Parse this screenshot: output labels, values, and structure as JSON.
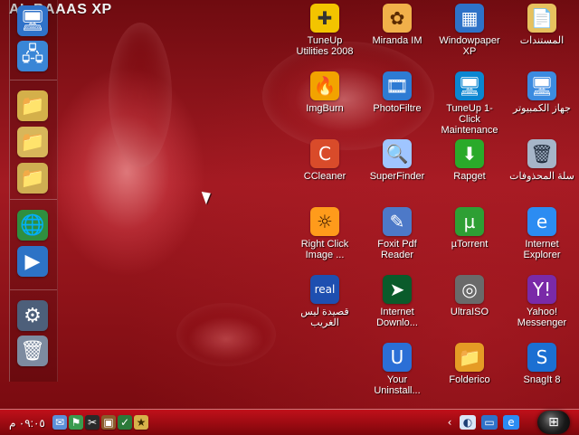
{
  "watermark": {
    "text": "AL BAAAS XP"
  },
  "taskbar": {
    "clock": "٠٩:٠٥ م",
    "start_icon_name": "windows-start-icon"
  },
  "dock": {
    "items": [
      {
        "icon": "my-computer-icon"
      },
      {
        "icon": "network-computer-icon"
      },
      {
        "icon": "folder-icon"
      },
      {
        "icon": "folder-icon"
      },
      {
        "icon": "folder-icon"
      },
      {
        "icon": "globe-icon"
      },
      {
        "icon": "media-player-icon"
      },
      {
        "icon": "settings-gear-icon"
      },
      {
        "icon": "recycle-bin-icon"
      }
    ]
  },
  "desktop": {
    "icons": [
      {
        "label": "TuneUp Utilities 2008",
        "icon": "tuneup-utilities-icon",
        "color": "#f3c400"
      },
      {
        "label": "Miranda IM",
        "icon": "miranda-im-icon",
        "color": "#f1b04a"
      },
      {
        "label": "Windowpaper XP",
        "icon": "windowpaper-xp-icon",
        "color": "#2e72c8"
      },
      {
        "label": "المستندات",
        "icon": "documents-folder-icon",
        "color": "#e7c15e"
      },
      {
        "label": "ImgBurn",
        "icon": "imgburn-icon",
        "color": "#f2a300"
      },
      {
        "label": "PhotoFiltre",
        "icon": "photofiltre-icon",
        "color": "#2e7bd3"
      },
      {
        "label": "TuneUp 1-Click Maintenance",
        "icon": "tuneup-1-click-icon",
        "color": "#0b86d1"
      },
      {
        "label": "جهاز الكمبيوتر",
        "icon": "my-computer-icon",
        "color": "#3c8be0"
      },
      {
        "label": "CCleaner",
        "icon": "ccleaner-icon",
        "color": "#d94b2a"
      },
      {
        "label": "SuperFinder",
        "icon": "superfinder-icon",
        "color": "#9fc5ff"
      },
      {
        "label": "Rapget",
        "icon": "rapget-icon",
        "color": "#2aaa2a"
      },
      {
        "label": "سلة المحذوفات",
        "icon": "recycle-bin-icon",
        "color": "#a6b5c8"
      },
      {
        "label": "Right Click Image ...",
        "icon": "right-click-image-icon",
        "color": "#ff9b1b"
      },
      {
        "label": "Foxit Pdf Reader",
        "icon": "foxit-pdf-reader-icon",
        "color": "#4d79c8"
      },
      {
        "label": "µTorrent",
        "icon": "utorrent-icon",
        "color": "#2e9f34"
      },
      {
        "label": "Internet Explorer",
        "icon": "internet-explorer-icon",
        "color": "#2c8cf2"
      },
      {
        "label": "قصيدة ليس الغريب",
        "icon": "real-player-icon",
        "color": "#1e4fb0"
      },
      {
        "label": "Internet Downlo...",
        "icon": "internet-download-manager-icon",
        "color": "#0a5b2b"
      },
      {
        "label": "UltraISO",
        "icon": "ultraiso-icon",
        "color": "#6a6a6a"
      },
      {
        "label": "Yahoo! Messenger",
        "icon": "yahoo-messenger-icon",
        "color": "#7a2aa8"
      },
      {
        "label": "Your Uninstall...",
        "icon": "your-uninstaller-icon",
        "color": "#2b6fd6"
      },
      {
        "label": "Folderico",
        "icon": "folderico-icon",
        "color": "#e59b25"
      },
      {
        "label": "SnagIt 8",
        "icon": "snagit-icon",
        "color": "#1b6fd2"
      }
    ]
  }
}
